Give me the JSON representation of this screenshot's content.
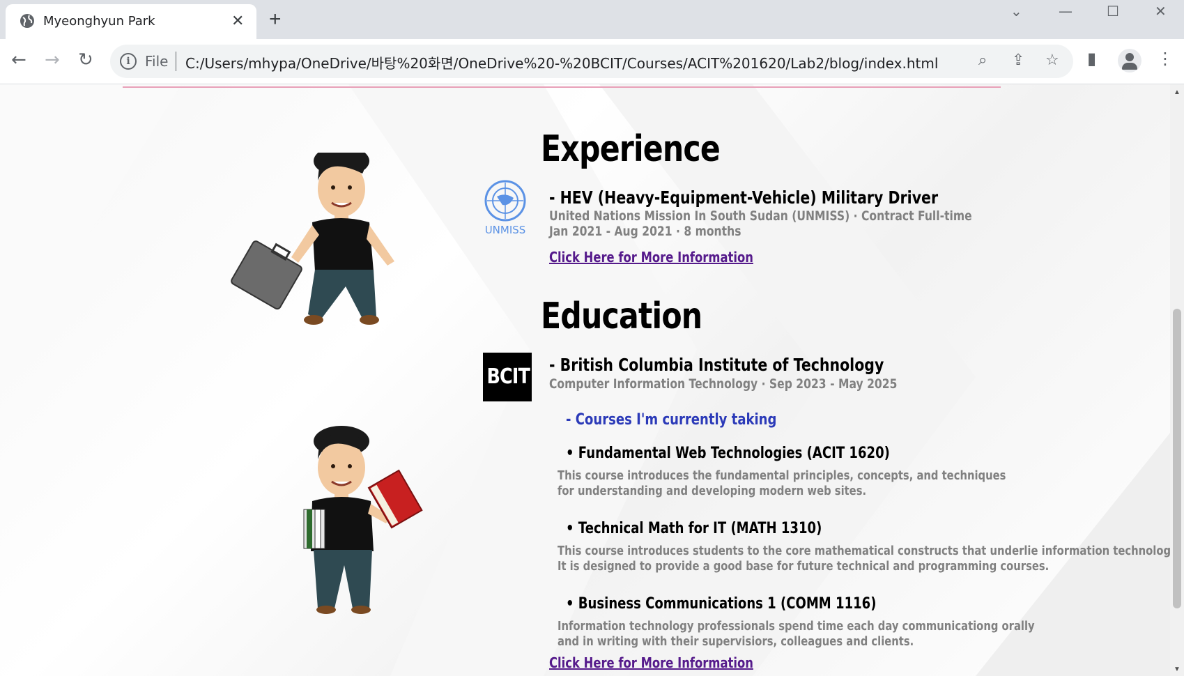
{
  "browser": {
    "tab_title": "Myeonghyun Park",
    "url_scheme_label": "File",
    "url": "C:/Users/mhypa/OneDrive/바탕%20화면/OneDrive%20-%20BCIT/Courses/ACIT%201620/Lab2/blog/index.html"
  },
  "experience": {
    "heading": "Experience",
    "logo_label": "UNMISS",
    "job_title": "- HEV (Heavy-Equipment-Vehicle) Military Driver",
    "organization": "United Nations Mission In South Sudan (UNMISS) · Contract Full-time",
    "dates": "Jan 2021 - Aug 2021 · 8 months",
    "link": "Click Here for More Information"
  },
  "education": {
    "heading": "Education",
    "logo_label": "BCIT",
    "school": "- British Columbia Institute of Technology",
    "program": "Computer Information Technology · Sep 2023 - May 2025",
    "courses_heading": "- Courses I'm currently taking",
    "courses": [
      {
        "title": "• Fundamental Web Technologies (ACIT 1620)",
        "desc_line1": "This course introduces the fundamental principles, concepts, and techniques",
        "desc_line2": "for understanding and developing modern web sites."
      },
      {
        "title": "• Technical Math for IT (MATH 1310)",
        "desc_line1": "This course introduces students to the core mathematical constructs that underlie information technology.",
        "desc_line2": "It is designed to provide a good base for future technical and programming courses."
      },
      {
        "title": "• Business Communications 1 (COMM 1116)",
        "desc_line1": "Information technology professionals spend time each day communicationg orally",
        "desc_line2": "and in writing with their supervisiors, colleagues and clients."
      }
    ],
    "link": "Click Here for More Information"
  },
  "colors": {
    "link": "#551a8b",
    "courses_heading": "#2b3ab8",
    "subtext": "#808080",
    "divider": "#e8a0b8"
  }
}
